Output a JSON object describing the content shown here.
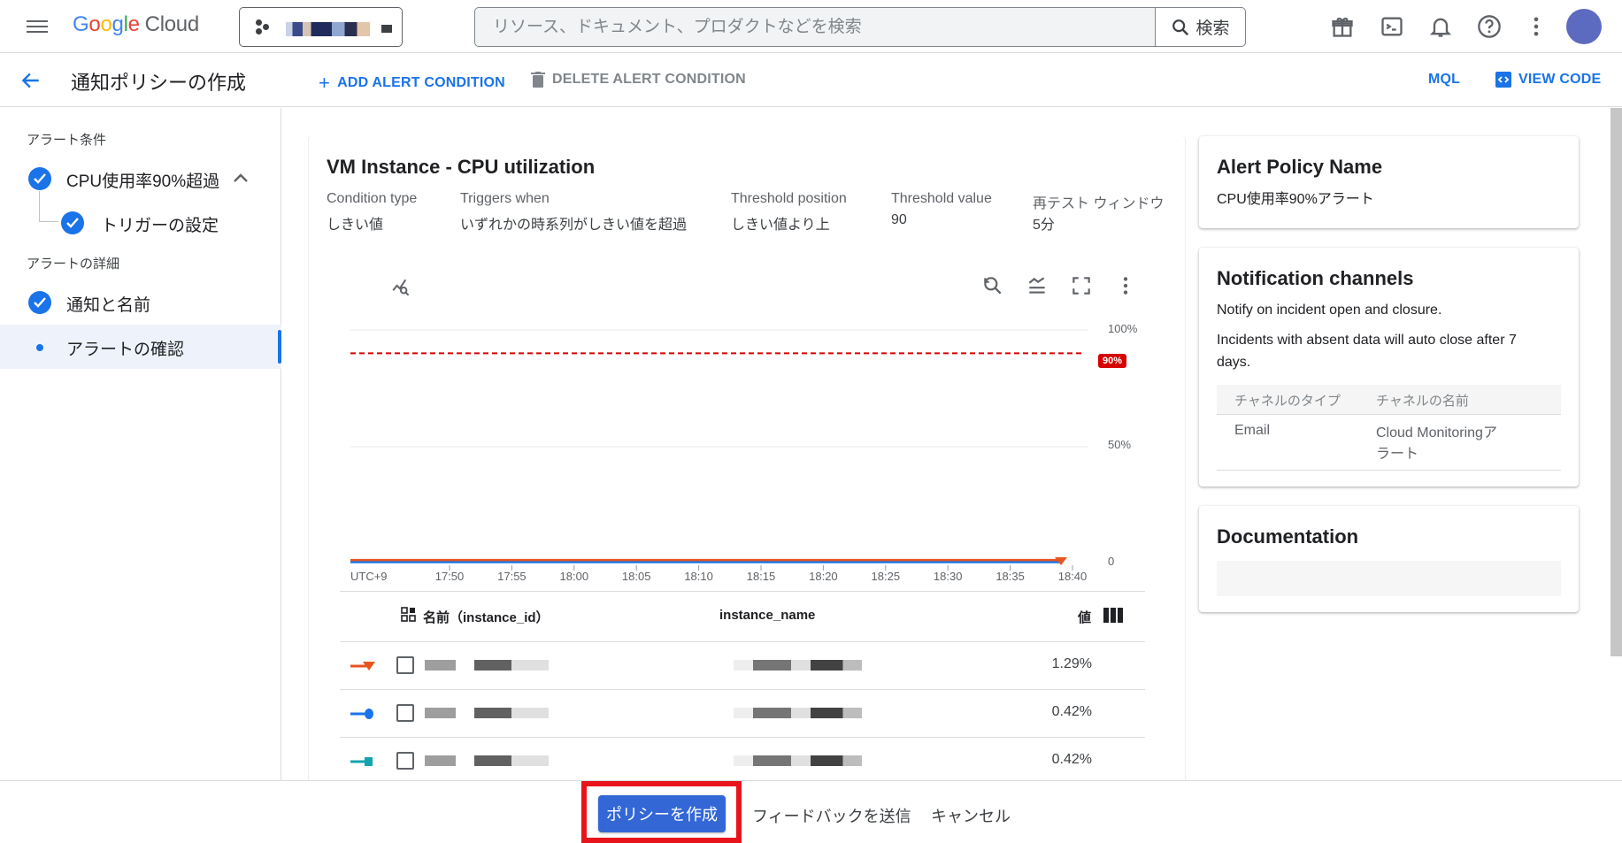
{
  "topbar": {
    "logo_parts": [
      "G",
      "o",
      "o",
      "g",
      "l",
      "e"
    ],
    "logo_product": "Cloud",
    "search_placeholder": "リソース、ドキュメント、プロダクトなどを検索",
    "search_button": "検索",
    "icons": [
      "gift-icon",
      "cloud-shell-icon",
      "notifications-icon",
      "help-icon",
      "more-vert-icon"
    ],
    "avatar_color": "#5c6bc0"
  },
  "actionbar": {
    "title": "通知ポリシーの作成",
    "add_condition": "ADD ALERT CONDITION",
    "delete_condition": "DELETE ALERT CONDITION",
    "mql": "MQL",
    "view_code": "VIEW CODE"
  },
  "sidebar": {
    "section1": "アラート条件",
    "condition": "CPU使用率90%超過",
    "trigger": "トリガーの設定",
    "section2": "アラートの詳細",
    "notify": "通知と名前",
    "review": "アラートの確認"
  },
  "condition": {
    "title": "VM Instance - CPU utilization",
    "fields": [
      {
        "key": "Condition type",
        "value": "しきい値"
      },
      {
        "key": "Triggers when",
        "value": "いずれかの時系列がしきい値を超過"
      },
      {
        "key": "Threshold position",
        "value": "しきい値より上"
      },
      {
        "key": "Threshold value",
        "value": "90"
      },
      {
        "key": "再テスト ウィンドウ",
        "value": "5分"
      }
    ]
  },
  "chart_data": {
    "type": "line",
    "title": "",
    "xlabel": "",
    "ylabel": "",
    "timezone_label": "UTC+9",
    "x": [
      "17:50",
      "17:55",
      "18:00",
      "18:05",
      "18:10",
      "18:15",
      "18:20",
      "18:25",
      "18:30",
      "18:35",
      "18:40"
    ],
    "y_ticks": [
      "100%",
      "50%",
      "0"
    ],
    "ylim": [
      0,
      100
    ],
    "threshold": {
      "value": 90,
      "label": "90%",
      "color": "#d50000"
    },
    "series": [
      {
        "name": "instance-1",
        "color": "#e8541f",
        "marker": "triangle",
        "values": [
          1.3,
          1.3,
          1.3,
          1.3,
          1.3,
          1.3,
          1.3,
          1.3,
          1.3,
          1.3,
          1.29
        ]
      },
      {
        "name": "instance-2",
        "color": "#1a73e8",
        "marker": "circle",
        "values": [
          0.42,
          0.42,
          0.42,
          0.42,
          0.42,
          0.42,
          0.42,
          0.42,
          0.42,
          0.42,
          0.42
        ]
      },
      {
        "name": "instance-3",
        "color": "#12a4af",
        "marker": "square",
        "values": [
          0.42,
          0.42,
          0.42,
          0.42,
          0.42,
          0.42,
          0.42,
          0.42,
          0.42,
          0.42,
          0.42
        ]
      }
    ]
  },
  "table": {
    "col_name": "名前（instance_id）",
    "col_instance": "instance_name",
    "col_value": "値",
    "rows": [
      {
        "value": "1.29%",
        "color": "#e8541f",
        "marker": "triangle"
      },
      {
        "value": "0.42%",
        "color": "#1a73e8",
        "marker": "circle"
      },
      {
        "value": "0.42%",
        "color": "#12a4af",
        "marker": "square"
      }
    ]
  },
  "policy": {
    "title": "Alert Policy Name",
    "name": "CPU使用率90%アラート"
  },
  "notifications": {
    "title": "Notification channels",
    "line1": "Notify on incident open and closure.",
    "line2": "Incidents with absent data will auto close after 7 days.",
    "col_type": "チャネルのタイプ",
    "col_name": "チャネルの名前",
    "rows": [
      {
        "type": "Email",
        "name": "Cloud Monitoringアラート"
      }
    ]
  },
  "documentation": {
    "title": "Documentation"
  },
  "footer": {
    "create": "ポリシーを作成",
    "feedback": "フィードバックを送信",
    "cancel": "キャンセル",
    "highlight_color": "#e8141c"
  }
}
